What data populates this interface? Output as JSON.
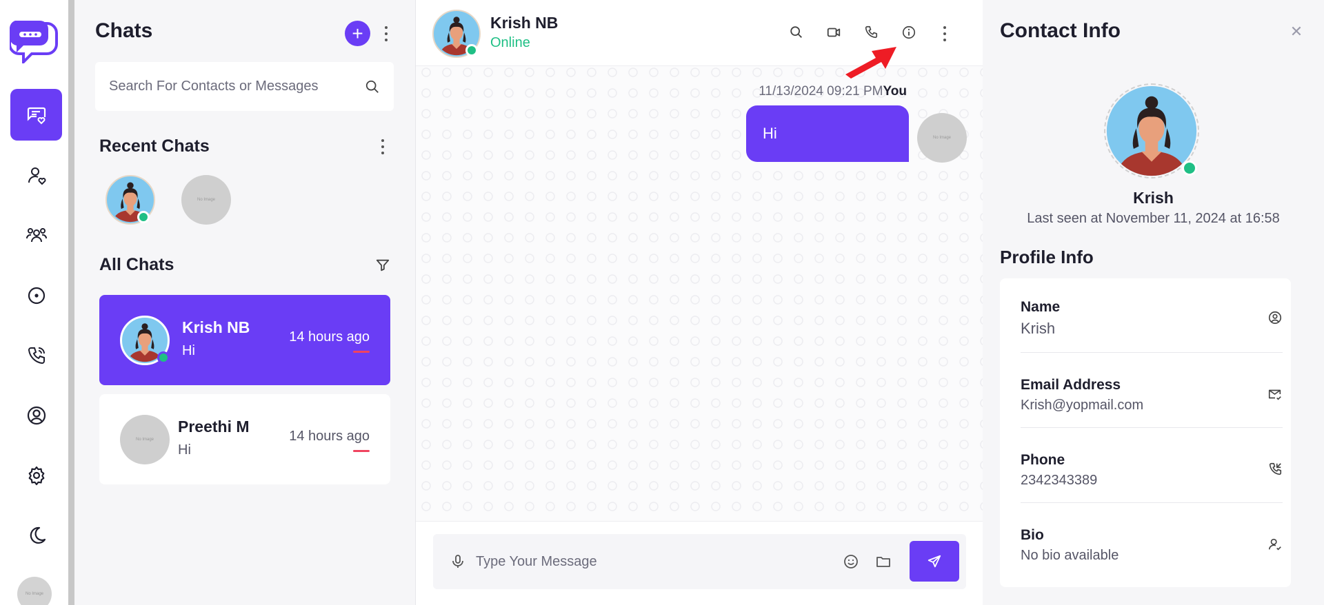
{
  "colors": {
    "accent": "#6a3df5",
    "online": "#1fbf85",
    "unread": "#f0445f",
    "panel_bg": "#f6f6f8",
    "arrow": "#ee1c25"
  },
  "rail": {
    "items": [
      {
        "icon": "chat-heart-icon",
        "active": true
      },
      {
        "icon": "contacts-icon",
        "active": false
      },
      {
        "icon": "group-icon",
        "active": false
      },
      {
        "icon": "status-icon",
        "active": false
      },
      {
        "icon": "calls-icon",
        "active": false
      },
      {
        "icon": "profile-icon",
        "active": false
      },
      {
        "icon": "settings-icon",
        "active": false
      },
      {
        "icon": "dark-mode-icon",
        "active": false
      }
    ],
    "avatar_label": "No Image"
  },
  "chat_list": {
    "title": "Chats",
    "search_placeholder": "Search For Contacts or Messages",
    "recent_title": "Recent Chats",
    "recent_placeholder_label": "No Image",
    "all_title": "All Chats",
    "chats": [
      {
        "name": "Krish NB",
        "message": "Hi",
        "time": "14 hours ago",
        "active": true,
        "online": true
      },
      {
        "name": "Preethi M",
        "message": "Hi",
        "time": "14 hours ago",
        "active": false,
        "online": false,
        "avatar_label": "No Image"
      }
    ]
  },
  "conversation": {
    "contact_name": "Krish NB",
    "status": "Online",
    "messages": [
      {
        "timestamp": "11/13/2024 09:21 PM",
        "sender": "You",
        "text": "Hi",
        "avatar_label": "No Image"
      }
    ],
    "composer_placeholder": "Type Your Message"
  },
  "contact_info": {
    "title": "Contact Info",
    "name": "Krish",
    "last_seen": "Last seen at November 11, 2024 at 16:58",
    "profile_title": "Profile Info",
    "fields": [
      {
        "label": "Name",
        "value": "Krish",
        "icon": "user-circle-icon"
      },
      {
        "label": "Email Address",
        "value": "Krish@yopmail.com",
        "icon": "mail-check-icon"
      },
      {
        "label": "Phone",
        "value": "2342343389",
        "icon": "phone-in-icon"
      },
      {
        "label": "Bio",
        "value": "No bio available",
        "icon": "user-check-icon"
      }
    ]
  }
}
